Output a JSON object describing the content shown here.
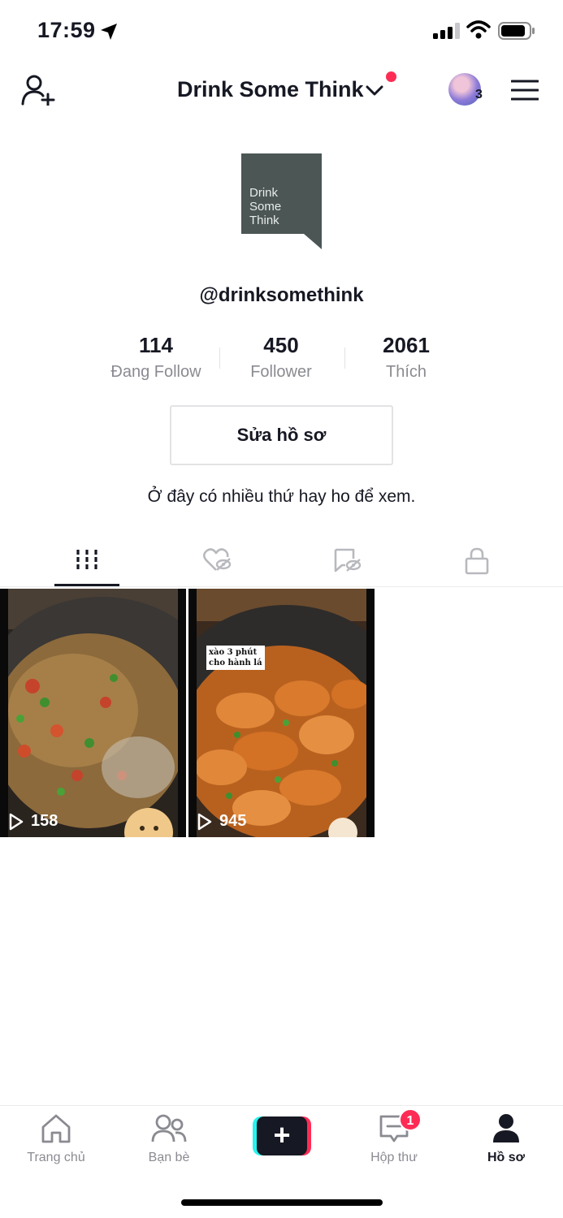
{
  "status_bar": {
    "time": "17:59",
    "icons": [
      "location-arrow-icon",
      "signal-icon",
      "wifi-icon",
      "battery-icon"
    ]
  },
  "header": {
    "account_name": "Drink Some Think",
    "avatar_count": "3",
    "icons": [
      "add-user-icon",
      "chevron-down-icon",
      "menu-icon"
    ]
  },
  "profile": {
    "logo_lines": [
      "Drink",
      "Some",
      "Think"
    ],
    "username": "@drinksomethink",
    "stats": [
      {
        "value": "114",
        "label": "Đang Follow"
      },
      {
        "value": "450",
        "label": "Follower"
      },
      {
        "value": "2061",
        "label": "Thích"
      }
    ],
    "edit_button": "Sửa hồ sơ",
    "bio": "Ở đây có nhiều thứ hay ho để xem."
  },
  "tabs": [
    {
      "icon": "grid-videos-icon",
      "active": true
    },
    {
      "icon": "liked-hidden-icon",
      "active": false
    },
    {
      "icon": "favorites-hidden-icon",
      "active": false
    },
    {
      "icon": "lock-icon",
      "active": false
    }
  ],
  "videos": [
    {
      "views": "158",
      "overlay_text": []
    },
    {
      "views": "945",
      "overlay_text": [
        "xào 3 phút",
        "cho hành lá"
      ]
    }
  ],
  "bottom_nav": {
    "items": [
      {
        "label": "Trang chủ",
        "icon": "home-icon",
        "active": false
      },
      {
        "label": "Bạn bè",
        "icon": "friends-icon",
        "active": false
      },
      {
        "label": "",
        "icon": "plus-icon",
        "active": false
      },
      {
        "label": "Hộp thư",
        "icon": "inbox-icon",
        "active": false,
        "badge": "1"
      },
      {
        "label": "Hồ sơ",
        "icon": "profile-icon",
        "active": true
      }
    ]
  },
  "colors": {
    "accent_red": "#fe2c55",
    "accent_cyan": "#25f4ee",
    "text_primary": "#161823",
    "text_secondary": "#8a8b91",
    "logo_bg": "#4b5655"
  }
}
